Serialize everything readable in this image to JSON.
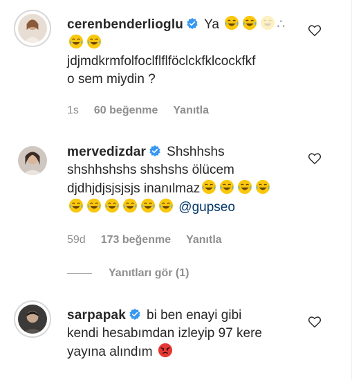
{
  "comments": [
    {
      "username": "cerenbenderlioglu",
      "text_line1": "Ya",
      "text_line3": "jdjmdkrmfolfoclflflföclckfklcockfkf",
      "text_line4": "o sem miydin ?",
      "time": "1s",
      "likes": "60 beğenme",
      "reply": "Yanıtla"
    },
    {
      "username": "mervedizdar",
      "text_line1": "Shshhshs",
      "text_line2": "shshhshshs shshshs ölücem",
      "text_line3": "djdhjdjsjsjsjs inanılmaz",
      "mention": "@gupseo",
      "time": "59d",
      "likes": "173 beğenme",
      "reply": "Yanıtla"
    },
    {
      "username": "sarpapak",
      "text_line1": "bi ben enayi gibi",
      "text_line2": "kendi hesabımdan izleyip 97 kere",
      "text_line3": "yayına alındım"
    }
  ],
  "view_replies": "Yanıtları gör (1)",
  "icons": {
    "verified": "verified-badge-icon",
    "like": "heart-outline-icon",
    "emoji_laugh": "tears-of-joy-emoji",
    "emoji_angry": "angry-face-emoji"
  },
  "colors": {
    "verified_blue": "#3897f0",
    "mention": "#003569",
    "muted": "#8e8e8e",
    "text": "#262626"
  }
}
